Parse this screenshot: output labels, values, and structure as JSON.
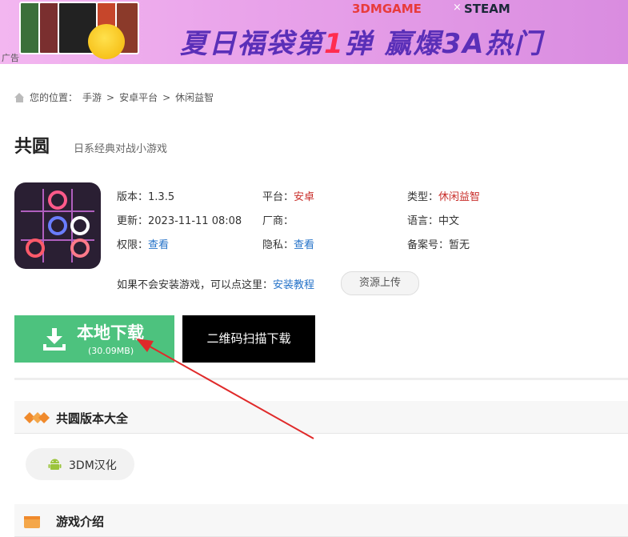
{
  "banner": {
    "ad_tag": "广告",
    "brand1": "3DMGAME",
    "brand_sep": "×",
    "brand2": "STEAM",
    "headline_a": "夏日福袋第",
    "headline_num": "1",
    "headline_b": "弹 赢爆3A热门",
    "colors": {
      "bg": "#e9a3ea",
      "headline": "#5a2fb8",
      "accent": "#ff2d4f"
    }
  },
  "breadcrumb": {
    "prefix": "您的位置：",
    "items": [
      "手游",
      "安卓平台",
      "休闲益智"
    ],
    "sep": ">"
  },
  "game": {
    "title": "共圆",
    "subtitle": "日系经典对战小游戏"
  },
  "info": {
    "version_label": "版本：",
    "version": "1.3.5",
    "platform_label": "平台：",
    "platform": "安卓",
    "type_label": "类型：",
    "type": "休闲益智",
    "updated_label": "更新：",
    "updated": "2023-11-11 08:08",
    "vendor_label": "厂商：",
    "vendor": "",
    "language_label": "语言：",
    "language": "中文",
    "permission_label": "权限：",
    "permission": "查看",
    "privacy_label": "隐私：",
    "privacy": "查看",
    "record_label": "备案号：",
    "record": "暂无"
  },
  "tip": {
    "text": "如果不会安装游戏，可以点这里：",
    "link": "安装教程",
    "upload": "资源上传"
  },
  "download": {
    "main": "本地下载",
    "size": "(30.09MB)",
    "qr": "二维码扫描下载",
    "color": "#4dc27e"
  },
  "versions": {
    "title": "共圆版本大全",
    "items": [
      "3DM汉化"
    ]
  },
  "intro": {
    "title": "游戏介绍"
  }
}
